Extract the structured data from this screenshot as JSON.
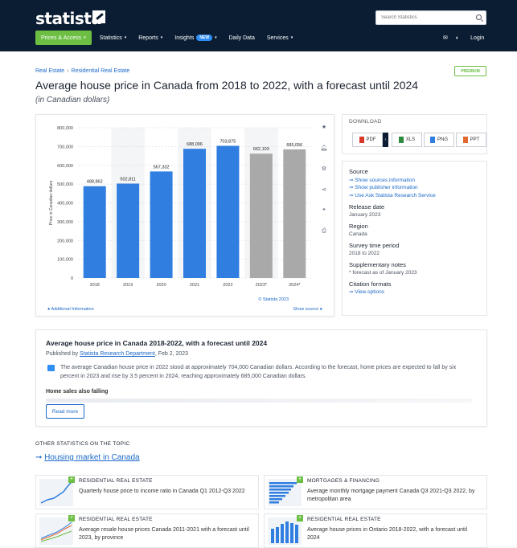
{
  "header": {
    "logo": "statista",
    "search_placeholder": "Search Statistics",
    "nav": [
      {
        "label": "Prices & Access",
        "caret": "▾"
      },
      {
        "label": "Statistics",
        "caret": "▾"
      },
      {
        "label": "Reports",
        "caret": "▾"
      },
      {
        "label": "Insights",
        "badge": "NEW",
        "caret": "▾"
      },
      {
        "label": "Daily Data"
      },
      {
        "label": "Services",
        "caret": "▾"
      }
    ],
    "login": "Login"
  },
  "breadcrumb": [
    "Real Estate",
    "Residential Real Estate"
  ],
  "premium_badge": "PREMIUM",
  "page": {
    "title": "Average house price in Canada from 2018 to 2022, with a forecast until 2024",
    "subtitle": "(in Canadian dollars)"
  },
  "chart_data": {
    "type": "bar",
    "title": "",
    "xlabel": "",
    "ylabel": "Price in Canadian dollars",
    "categories": [
      "2018",
      "2019",
      "2020",
      "2021",
      "2022",
      "2023*",
      "2024*"
    ],
    "values": [
      488862,
      502811,
      567332,
      688096,
      703875,
      662103,
      685056
    ],
    "value_labels": [
      "488,862",
      "502,811",
      "567,332",
      "688,096",
      "703,875",
      "662,103",
      "685,056"
    ],
    "bar_colors": [
      "#2f7ee0",
      "#2f7ee0",
      "#2f7ee0",
      "#2f7ee0",
      "#2f7ee0",
      "#a9a9a9",
      "#a9a9a9"
    ],
    "ylim": [
      0,
      800000
    ],
    "yticks": [
      0,
      100000,
      200000,
      300000,
      400000,
      500000,
      600000,
      700000,
      800000
    ],
    "ytick_labels": [
      "0",
      "100,000",
      "200,000",
      "300,000",
      "400,000",
      "500,000",
      "600,000",
      "700,000",
      "800,000"
    ],
    "grid": true
  },
  "chart_footer": {
    "additional_info": "Additional Information",
    "copyright": "© Statista 2023",
    "show_source": "Show source"
  },
  "download": {
    "title": "DOWNLOAD",
    "buttons": [
      "PDF",
      "XLS",
      "PNG",
      "PPT"
    ]
  },
  "meta": {
    "source_label": "Source",
    "source_links": [
      "Show sources information",
      "Show publisher information",
      "Use Ask Statista Research Service"
    ],
    "release_label": "Release date",
    "release_value": "January 2023",
    "region_label": "Region",
    "region_value": "Canada",
    "survey_label": "Survey time period",
    "survey_value": "2018 to 2022",
    "notes_label": "Supplementary notes",
    "notes_value": "* forecast as of January 2023",
    "citation_label": "Citation formats",
    "citation_link": "View options"
  },
  "summary": {
    "title": "Average house price in Canada 2018-2022, with a forecast until 2024",
    "published_prefix": "Published by",
    "publisher": "Statista Research Department",
    "published_date": ", Feb 2, 2023",
    "text": "The average Canadian house price in 2022 stood at approximately 704,000 Canadian dollars. According to the forecast, home prices are expected to fall by six percent in 2023 and rise by 3.5 percent in 2024, reaching approximately 685,000 Canadian dollars.",
    "subheading": "Home sales also falling",
    "read_more": "Read more"
  },
  "other": {
    "heading": "OTHER STATISTICS ON THE TOPIC",
    "topic_link": "Housing market in Canada",
    "cards": [
      {
        "category": "RESIDENTIAL REAL ESTATE",
        "title": "Quarterly house price to income ratio in Canada Q1 2012-Q3 2022"
      },
      {
        "category": "MORTGAGES & FINANCING",
        "title": "Average monthly mortgage payment Canada Q3 2021-Q3 2022, by metropolitan area"
      },
      {
        "category": "RESIDENTIAL REAL ESTATE",
        "title": "Average resale house prices Canada 2011-2021 with a forecast until 2023, by province"
      },
      {
        "category": "RESIDENTIAL REAL ESTATE",
        "title": "Average house prices in Ontario 2018-2022, with a forecast until 2024"
      }
    ]
  }
}
